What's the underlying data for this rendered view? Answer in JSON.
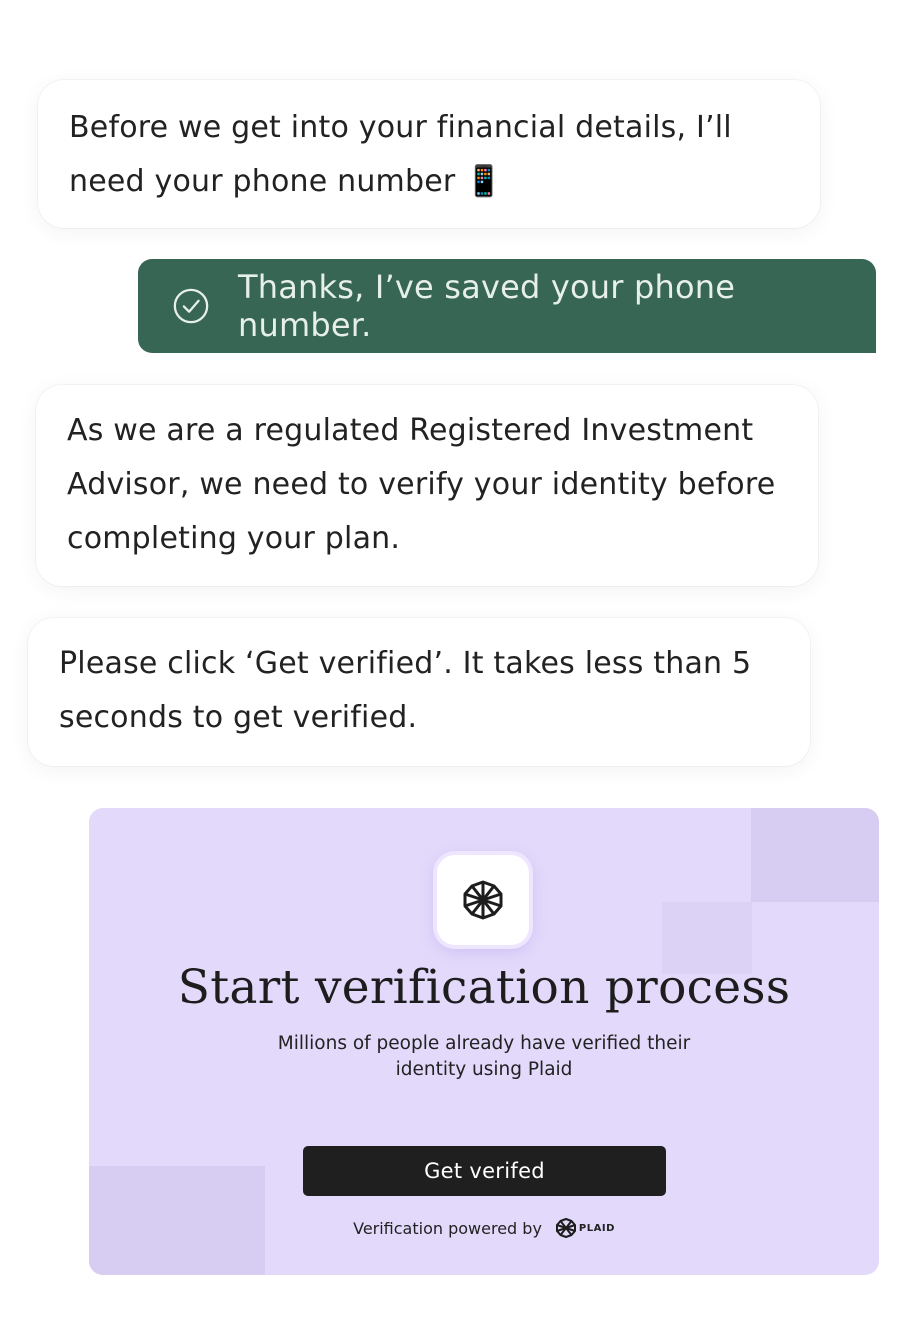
{
  "chat": {
    "message_1": "Before we get into your financial details, I’ll need your phone number 📱",
    "confirmation": "Thanks, I’ve saved your phone number.",
    "message_2": "As we are a regulated Registered Investment Advisor, we need to verify your identity before completing your plan.",
    "message_3": "Please click ‘Get verified’. It takes less than 5 seconds to get verified."
  },
  "verification_card": {
    "title": "Start verification process",
    "subtitle": "Millions of people already have verified their identity using Plaid",
    "button_label": "Get verifed",
    "powered_by": "Verification powered by",
    "brand_name": "PLAID"
  },
  "colors": {
    "confirmation_bg": "#376655",
    "card_bg": "#e2d9fb",
    "button_bg": "#1f1f1f"
  },
  "icons": {
    "confirmation": "check-circle-icon",
    "card_logo": "plaid-logo-icon"
  }
}
